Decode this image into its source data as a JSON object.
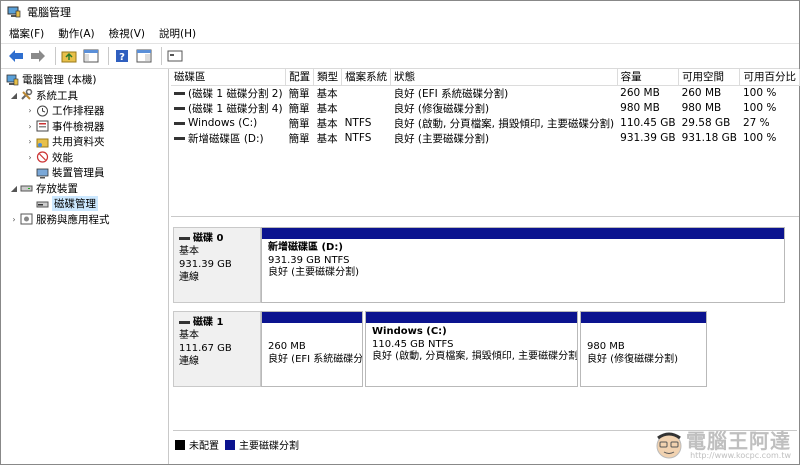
{
  "window": {
    "title": "電腦管理"
  },
  "menu": [
    "檔案(F)",
    "動作(A)",
    "檢視(V)",
    "說明(H)"
  ],
  "toolbar": {
    "icons": [
      "back-icon",
      "forward-icon",
      "up-folder-icon",
      "show-hide-tree-icon",
      "help-icon",
      "properties-icon",
      "console-icon"
    ]
  },
  "tree": {
    "root": "電腦管理 (本機)",
    "system_tools": "系統工具",
    "task_scheduler": "工作排程器",
    "event_viewer": "事件檢視器",
    "shared_folders": "共用資料夾",
    "performance": "效能",
    "device_manager": "裝置管理員",
    "storage": "存放裝置",
    "disk_management": "磁碟管理",
    "services": "服務與應用程式"
  },
  "volumes": {
    "headers": [
      "磁碟區",
      "配置",
      "類型",
      "檔案系統",
      "狀態",
      "容量",
      "可用空間",
      "可用百分比"
    ],
    "rows": [
      {
        "name": "(磁碟 1 磁碟分割 2)",
        "layout": "簡單",
        "type": "基本",
        "fs": "",
        "status": "良好 (EFI 系統磁碟分割)",
        "capacity": "260 MB",
        "free": "260 MB",
        "pct": "100 %"
      },
      {
        "name": "(磁碟 1 磁碟分割 4)",
        "layout": "簡單",
        "type": "基本",
        "fs": "",
        "status": "良好 (修復磁碟分割)",
        "capacity": "980 MB",
        "free": "980 MB",
        "pct": "100 %"
      },
      {
        "name": "Windows (C:)",
        "layout": "簡單",
        "type": "基本",
        "fs": "NTFS",
        "status": "良好 (啟動, 分頁檔案, 損毀傾印, 主要磁碟分割)",
        "capacity": "110.45 GB",
        "free": "29.58 GB",
        "pct": "27 %"
      },
      {
        "name": "新增磁碟區 (D:)",
        "layout": "簡單",
        "type": "基本",
        "fs": "NTFS",
        "status": "良好 (主要磁碟分割)",
        "capacity": "931.39 GB",
        "free": "931.18 GB",
        "pct": "100 %"
      }
    ]
  },
  "disk0": {
    "name": "磁碟 0",
    "type": "基本",
    "size": "931.39 GB",
    "state": "連線",
    "p1": {
      "name": "新增磁碟區 (D:)",
      "size": "931.39 GB NTFS",
      "status": "良好 (主要磁碟分割)"
    }
  },
  "disk1": {
    "name": "磁碟 1",
    "type": "基本",
    "size": "111.67 GB",
    "state": "連線",
    "p1": {
      "size": "260 MB",
      "status": "良好 (EFI 系統磁碟分割)"
    },
    "p2": {
      "name": "Windows (C:)",
      "size": "110.45 GB NTFS",
      "status": "良好 (啟動, 分頁檔案, 損毀傾印, 主要磁碟分割)"
    },
    "p3": {
      "size": "980 MB",
      "status": "良好 (修復磁碟分割)"
    }
  },
  "legend": {
    "unallocated": "未配置",
    "primary": "主要磁碟分割"
  },
  "colors": {
    "primary_partition": "#0b138f",
    "unallocated": "#000000",
    "selection": "#cce8ff"
  },
  "watermark": {
    "text": "電腦王阿達",
    "url": "http://www.kocpc.com.tw"
  }
}
